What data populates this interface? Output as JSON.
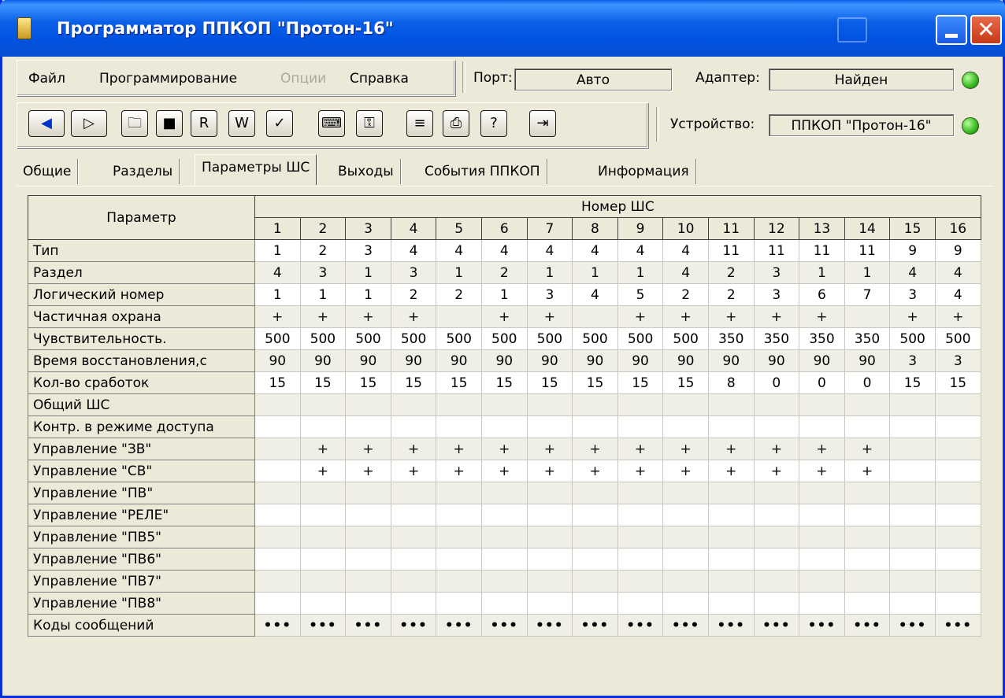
{
  "window": {
    "title": "Программатор ППКОП \"Протон-16\""
  },
  "menu": {
    "file": "Файл",
    "programming": "Программирование",
    "options": "Опции",
    "help": "Справка"
  },
  "port": {
    "label": "Порт:",
    "value": "Авто"
  },
  "adapter": {
    "label": "Адаптер:",
    "value": "Найден"
  },
  "device": {
    "label": "Устройство:",
    "value": "ППКОП \"Протон-16\""
  },
  "toolbar": {
    "buttons": [
      {
        "name": "back-icon",
        "glyph": "◀"
      },
      {
        "name": "forward-icon",
        "glyph": "▷"
      },
      {
        "name": "open-folder-icon",
        "glyph": "🗀"
      },
      {
        "name": "save-disk-icon",
        "glyph": "■"
      },
      {
        "name": "read-device-icon",
        "glyph": "R"
      },
      {
        "name": "write-device-icon",
        "glyph": "W"
      },
      {
        "name": "verify-device-icon",
        "glyph": "✓"
      },
      {
        "name": "keyboard-icon",
        "glyph": "⌨"
      },
      {
        "name": "key-icon",
        "glyph": "⚿"
      },
      {
        "name": "document-icon",
        "glyph": "≡"
      },
      {
        "name": "print-icon",
        "glyph": "⎙"
      },
      {
        "name": "help-icon",
        "glyph": "?"
      },
      {
        "name": "exit-icon",
        "glyph": "⇥"
      }
    ]
  },
  "tabs": [
    "Общие",
    "Разделы",
    "Параметры ШС",
    "Выходы",
    "События ППКОП",
    "Информация"
  ],
  "active_tab": "Параметры ШС",
  "grid": {
    "param_header": "Параметр",
    "number_header": "Номер ШС",
    "columns": [
      "1",
      "2",
      "3",
      "4",
      "5",
      "6",
      "7",
      "8",
      "9",
      "10",
      "11",
      "12",
      "13",
      "14",
      "15",
      "16"
    ],
    "rows": [
      {
        "label": "Тип",
        "values": [
          "1",
          "2",
          "3",
          "4",
          "4",
          "4",
          "4",
          "4",
          "4",
          "4",
          "11",
          "11",
          "11",
          "11",
          "9",
          "9"
        ]
      },
      {
        "label": "Раздел",
        "values": [
          "4",
          "3",
          "1",
          "3",
          "1",
          "2",
          "1",
          "1",
          "1",
          "4",
          "2",
          "3",
          "1",
          "1",
          "4",
          "4"
        ]
      },
      {
        "label": "Логический номер",
        "values": [
          "1",
          "1",
          "1",
          "2",
          "2",
          "1",
          "3",
          "4",
          "5",
          "2",
          "2",
          "3",
          "6",
          "7",
          "3",
          "4"
        ]
      },
      {
        "label": "Частичная охрана",
        "values": [
          "+",
          "+",
          "+",
          "+",
          "",
          "+",
          "+",
          "",
          "+",
          "+",
          "+",
          "+",
          "+",
          "",
          "+",
          "+"
        ]
      },
      {
        "label": "Чувствительность.",
        "values": [
          "500",
          "500",
          "500",
          "500",
          "500",
          "500",
          "500",
          "500",
          "500",
          "500",
          "350",
          "350",
          "350",
          "350",
          "500",
          "500"
        ]
      },
      {
        "label": "Время восстановления,с",
        "values": [
          "90",
          "90",
          "90",
          "90",
          "90",
          "90",
          "90",
          "90",
          "90",
          "90",
          "90",
          "90",
          "90",
          "90",
          "3",
          "3"
        ]
      },
      {
        "label": "Кол-во сработок",
        "values": [
          "15",
          "15",
          "15",
          "15",
          "15",
          "15",
          "15",
          "15",
          "15",
          "15",
          "8",
          "0",
          "0",
          "0",
          "15",
          "15"
        ]
      },
      {
        "label": "Общий ШС",
        "values": [
          "",
          "",
          "",
          "",
          "",
          "",
          "",
          "",
          "",
          "",
          "",
          "",
          "",
          "",
          "",
          ""
        ]
      },
      {
        "label": "Контр. в режиме доступа",
        "values": [
          "",
          "",
          "",
          "",
          "",
          "",
          "",
          "",
          "",
          "",
          "",
          "",
          "",
          "",
          "",
          ""
        ]
      },
      {
        "label": "Управление \"ЗВ\"",
        "values": [
          "",
          "+",
          "+",
          "+",
          "+",
          "+",
          "+",
          "+",
          "+",
          "+",
          "+",
          "+",
          "+",
          "+",
          "",
          ""
        ]
      },
      {
        "label": "Управление \"СВ\"",
        "values": [
          "",
          "+",
          "+",
          "+",
          "+",
          "+",
          "+",
          "+",
          "+",
          "+",
          "+",
          "+",
          "+",
          "+",
          "",
          ""
        ]
      },
      {
        "label": "Управление \"ПВ\"",
        "values": [
          "",
          "",
          "",
          "",
          "",
          "",
          "",
          "",
          "",
          "",
          "",
          "",
          "",
          "",
          "",
          ""
        ]
      },
      {
        "label": "Управление \"РЕЛЕ\"",
        "values": [
          "",
          "",
          "",
          "",
          "",
          "",
          "",
          "",
          "",
          "",
          "",
          "",
          "",
          "",
          "",
          ""
        ]
      },
      {
        "label": "Управление \"ПВ5\"",
        "values": [
          "",
          "",
          "",
          "",
          "",
          "",
          "",
          "",
          "",
          "",
          "",
          "",
          "",
          "",
          "",
          ""
        ]
      },
      {
        "label": "Управление \"ПВ6\"",
        "values": [
          "",
          "",
          "",
          "",
          "",
          "",
          "",
          "",
          "",
          "",
          "",
          "",
          "",
          "",
          "",
          ""
        ]
      },
      {
        "label": "Управление \"ПВ7\"",
        "values": [
          "",
          "",
          "",
          "",
          "",
          "",
          "",
          "",
          "",
          "",
          "",
          "",
          "",
          "",
          "",
          ""
        ]
      },
      {
        "label": "Управление \"ПВ8\"",
        "values": [
          "",
          "",
          "",
          "",
          "",
          "",
          "",
          "",
          "",
          "",
          "",
          "",
          "",
          "",
          "",
          ""
        ]
      },
      {
        "label": "Коды сообщений",
        "values": [
          "•••",
          "•••",
          "•••",
          "•••",
          "•••",
          "•••",
          "•••",
          "•••",
          "•••",
          "•••",
          "•••",
          "•••",
          "•••",
          "•••",
          "•••",
          "•••"
        ]
      }
    ]
  },
  "colors": {
    "titlebar": "#0a5ee6",
    "led": "#36b820",
    "face": "#ece9d8"
  }
}
